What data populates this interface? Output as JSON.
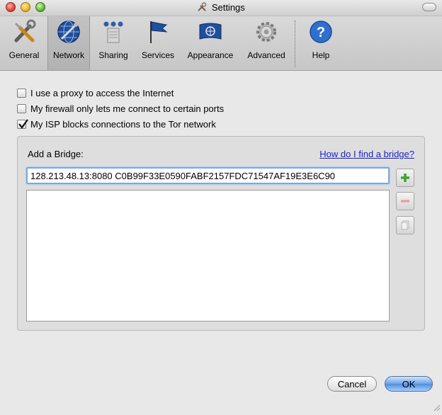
{
  "window": {
    "title": "Settings"
  },
  "toolbar": {
    "items": [
      {
        "label": "General",
        "icon": "general-tools-icon",
        "selected": false
      },
      {
        "label": "Network",
        "icon": "network-globe-icon",
        "selected": true
      },
      {
        "label": "Sharing",
        "icon": "sharing-icon",
        "selected": false
      },
      {
        "label": "Services",
        "icon": "services-flag-icon",
        "selected": false
      },
      {
        "label": "Appearance",
        "icon": "appearance-flag-icon",
        "selected": false
      },
      {
        "label": "Advanced",
        "icon": "advanced-gear-icon",
        "selected": false
      },
      {
        "label": "Help",
        "icon": "help-icon",
        "selected": false
      }
    ]
  },
  "options": {
    "proxy": {
      "label": "I use a proxy to access the Internet",
      "checked": false
    },
    "firewall": {
      "label": "My firewall only lets me connect to certain ports",
      "checked": false
    },
    "isp_blocks": {
      "label": "My ISP blocks connections to the Tor network",
      "checked": true
    }
  },
  "bridges": {
    "add_label": "Add a Bridge:",
    "help_link": "How do I find a bridge?",
    "input_value": "128.213.48.13:8080 C0B99F33E0590FABF2157FDC71547AF19E3E6C90",
    "list_items": []
  },
  "buttons": {
    "cancel": "Cancel",
    "ok": "OK"
  },
  "colors": {
    "link": "#1a22d8",
    "accent": "#4d8fe0",
    "add_green": "#3ea52f"
  }
}
